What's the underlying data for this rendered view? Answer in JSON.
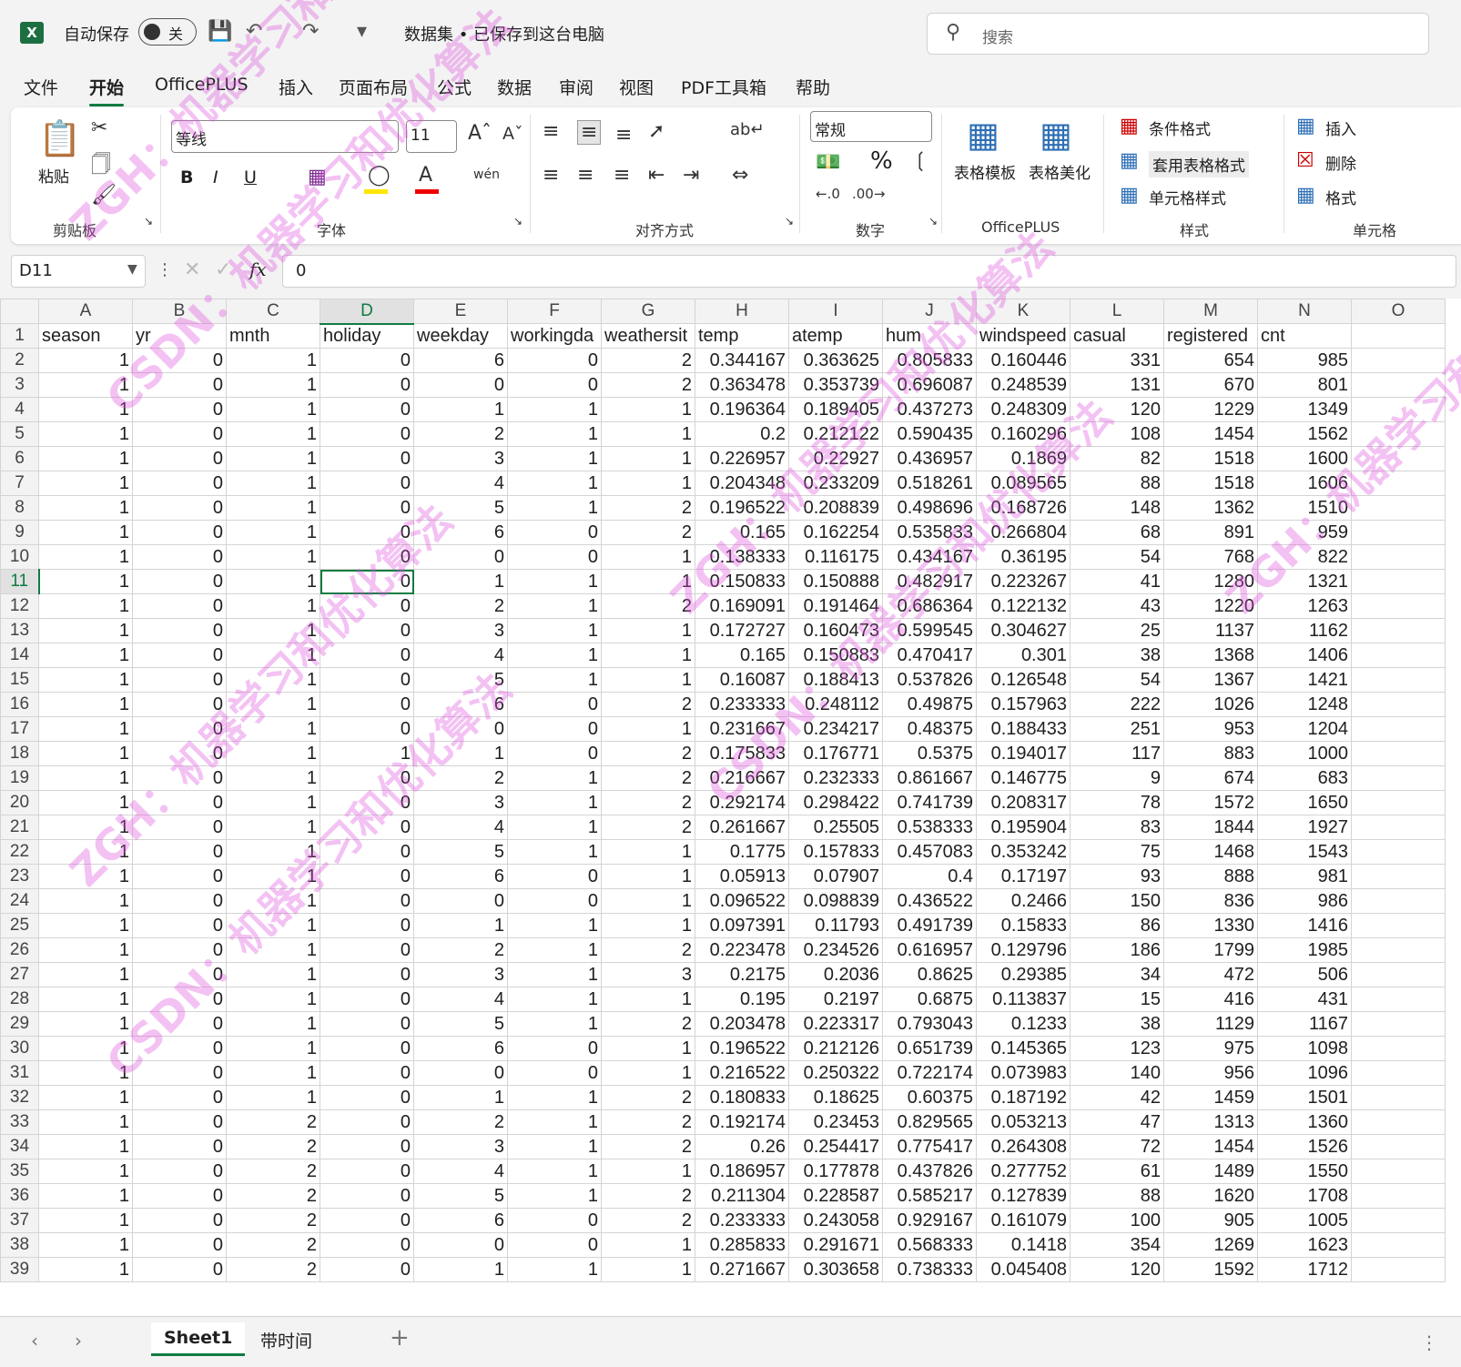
{
  "titlebar": {
    "app_icon_letter": "X",
    "autosave_label": "自动保存",
    "autosave_state": "关",
    "doc_title": "数据集 • 已保存到这台电脑",
    "search_placeholder": "搜索"
  },
  "menu_tabs": [
    "文件",
    "开始",
    "OfficePLUS",
    "插入",
    "页面布局",
    "公式",
    "数据",
    "审阅",
    "视图",
    "PDF工具箱",
    "帮助"
  ],
  "ribbon": {
    "clipboard": {
      "paste": "粘贴",
      "group": "剪贴板"
    },
    "font": {
      "name": "等线",
      "size": "11",
      "group": "字体",
      "bold": "B",
      "italic": "I",
      "underline": "U"
    },
    "alignment": {
      "group": "对齐方式"
    },
    "number": {
      "format": "常规",
      "group": "数字",
      "percent": "%"
    },
    "officeplus": {
      "template": "表格模板",
      "beautify": "表格美化",
      "group": "OfficePLUS"
    },
    "styles": {
      "conditional": "条件格式",
      "table_format": "套用表格格式",
      "cell_styles": "单元格样式",
      "group": "样式"
    },
    "cells": {
      "insert": "插入",
      "delete": "删除",
      "format": "格式",
      "group": "单元格"
    }
  },
  "formula_bar": {
    "name_box": "D11",
    "fx": "fx",
    "value": "0"
  },
  "grid": {
    "active_col": "D",
    "active_row": "11",
    "col_headers": [
      "A",
      "B",
      "C",
      "D",
      "E",
      "F",
      "G",
      "H",
      "I",
      "J",
      "K",
      "L",
      "M",
      "N",
      "O"
    ],
    "headers": [
      "season",
      "yr",
      "mnth",
      "holiday",
      "weekday",
      "workingda",
      "weathersit",
      "temp",
      "atemp",
      "hum",
      "windspeed",
      "casual",
      "registered",
      "cnt"
    ],
    "rows": [
      [
        "1",
        "0",
        "1",
        "0",
        "6",
        "0",
        "2",
        "0.344167",
        "0.363625",
        "0.805833",
        "0.160446",
        "331",
        "654",
        "985"
      ],
      [
        "1",
        "0",
        "1",
        "0",
        "0",
        "0",
        "2",
        "0.363478",
        "0.353739",
        "0.696087",
        "0.248539",
        "131",
        "670",
        "801"
      ],
      [
        "1",
        "0",
        "1",
        "0",
        "1",
        "1",
        "1",
        "0.196364",
        "0.189405",
        "0.437273",
        "0.248309",
        "120",
        "1229",
        "1349"
      ],
      [
        "1",
        "0",
        "1",
        "0",
        "2",
        "1",
        "1",
        "0.2",
        "0.212122",
        "0.590435",
        "0.160296",
        "108",
        "1454",
        "1562"
      ],
      [
        "1",
        "0",
        "1",
        "0",
        "3",
        "1",
        "1",
        "0.226957",
        "0.22927",
        "0.436957",
        "0.1869",
        "82",
        "1518",
        "1600"
      ],
      [
        "1",
        "0",
        "1",
        "0",
        "4",
        "1",
        "1",
        "0.204348",
        "0.233209",
        "0.518261",
        "0.089565",
        "88",
        "1518",
        "1606"
      ],
      [
        "1",
        "0",
        "1",
        "0",
        "5",
        "1",
        "2",
        "0.196522",
        "0.208839",
        "0.498696",
        "0.168726",
        "148",
        "1362",
        "1510"
      ],
      [
        "1",
        "0",
        "1",
        "0",
        "6",
        "0",
        "2",
        "0.165",
        "0.162254",
        "0.535833",
        "0.266804",
        "68",
        "891",
        "959"
      ],
      [
        "1",
        "0",
        "1",
        "0",
        "0",
        "0",
        "1",
        "0.138333",
        "0.116175",
        "0.434167",
        "0.36195",
        "54",
        "768",
        "822"
      ],
      [
        "1",
        "0",
        "1",
        "0",
        "1",
        "1",
        "1",
        "0.150833",
        "0.150888",
        "0.482917",
        "0.223267",
        "41",
        "1280",
        "1321"
      ],
      [
        "1",
        "0",
        "1",
        "0",
        "2",
        "1",
        "2",
        "0.169091",
        "0.191464",
        "0.686364",
        "0.122132",
        "43",
        "1220",
        "1263"
      ],
      [
        "1",
        "0",
        "1",
        "0",
        "3",
        "1",
        "1",
        "0.172727",
        "0.160473",
        "0.599545",
        "0.304627",
        "25",
        "1137",
        "1162"
      ],
      [
        "1",
        "0",
        "1",
        "0",
        "4",
        "1",
        "1",
        "0.165",
        "0.150883",
        "0.470417",
        "0.301",
        "38",
        "1368",
        "1406"
      ],
      [
        "1",
        "0",
        "1",
        "0",
        "5",
        "1",
        "1",
        "0.16087",
        "0.188413",
        "0.537826",
        "0.126548",
        "54",
        "1367",
        "1421"
      ],
      [
        "1",
        "0",
        "1",
        "0",
        "6",
        "0",
        "2",
        "0.233333",
        "0.248112",
        "0.49875",
        "0.157963",
        "222",
        "1026",
        "1248"
      ],
      [
        "1",
        "0",
        "1",
        "0",
        "0",
        "0",
        "1",
        "0.231667",
        "0.234217",
        "0.48375",
        "0.188433",
        "251",
        "953",
        "1204"
      ],
      [
        "1",
        "0",
        "1",
        "1",
        "1",
        "0",
        "2",
        "0.175833",
        "0.176771",
        "0.5375",
        "0.194017",
        "117",
        "883",
        "1000"
      ],
      [
        "1",
        "0",
        "1",
        "0",
        "2",
        "1",
        "2",
        "0.216667",
        "0.232333",
        "0.861667",
        "0.146775",
        "9",
        "674",
        "683"
      ],
      [
        "1",
        "0",
        "1",
        "0",
        "3",
        "1",
        "2",
        "0.292174",
        "0.298422",
        "0.741739",
        "0.208317",
        "78",
        "1572",
        "1650"
      ],
      [
        "1",
        "0",
        "1",
        "0",
        "4",
        "1",
        "2",
        "0.261667",
        "0.25505",
        "0.538333",
        "0.195904",
        "83",
        "1844",
        "1927"
      ],
      [
        "1",
        "0",
        "1",
        "0",
        "5",
        "1",
        "1",
        "0.1775",
        "0.157833",
        "0.457083",
        "0.353242",
        "75",
        "1468",
        "1543"
      ],
      [
        "1",
        "0",
        "1",
        "0",
        "6",
        "0",
        "1",
        "0.05913",
        "0.07907",
        "0.4",
        "0.17197",
        "93",
        "888",
        "981"
      ],
      [
        "1",
        "0",
        "1",
        "0",
        "0",
        "0",
        "1",
        "0.096522",
        "0.098839",
        "0.436522",
        "0.2466",
        "150",
        "836",
        "986"
      ],
      [
        "1",
        "0",
        "1",
        "0",
        "1",
        "1",
        "1",
        "0.097391",
        "0.11793",
        "0.491739",
        "0.15833",
        "86",
        "1330",
        "1416"
      ],
      [
        "1",
        "0",
        "1",
        "0",
        "2",
        "1",
        "2",
        "0.223478",
        "0.234526",
        "0.616957",
        "0.129796",
        "186",
        "1799",
        "1985"
      ],
      [
        "1",
        "0",
        "1",
        "0",
        "3",
        "1",
        "3",
        "0.2175",
        "0.2036",
        "0.8625",
        "0.29385",
        "34",
        "472",
        "506"
      ],
      [
        "1",
        "0",
        "1",
        "0",
        "4",
        "1",
        "1",
        "0.195",
        "0.2197",
        "0.6875",
        "0.113837",
        "15",
        "416",
        "431"
      ],
      [
        "1",
        "0",
        "1",
        "0",
        "5",
        "1",
        "2",
        "0.203478",
        "0.223317",
        "0.793043",
        "0.1233",
        "38",
        "1129",
        "1167"
      ],
      [
        "1",
        "0",
        "1",
        "0",
        "6",
        "0",
        "1",
        "0.196522",
        "0.212126",
        "0.651739",
        "0.145365",
        "123",
        "975",
        "1098"
      ],
      [
        "1",
        "0",
        "1",
        "0",
        "0",
        "0",
        "1",
        "0.216522",
        "0.250322",
        "0.722174",
        "0.073983",
        "140",
        "956",
        "1096"
      ],
      [
        "1",
        "0",
        "1",
        "0",
        "1",
        "1",
        "2",
        "0.180833",
        "0.18625",
        "0.60375",
        "0.187192",
        "42",
        "1459",
        "1501"
      ],
      [
        "1",
        "0",
        "2",
        "0",
        "2",
        "1",
        "2",
        "0.192174",
        "0.23453",
        "0.829565",
        "0.053213",
        "47",
        "1313",
        "1360"
      ],
      [
        "1",
        "0",
        "2",
        "0",
        "3",
        "1",
        "2",
        "0.26",
        "0.254417",
        "0.775417",
        "0.264308",
        "72",
        "1454",
        "1526"
      ],
      [
        "1",
        "0",
        "2",
        "0",
        "4",
        "1",
        "1",
        "0.186957",
        "0.177878",
        "0.437826",
        "0.277752",
        "61",
        "1489",
        "1550"
      ],
      [
        "1",
        "0",
        "2",
        "0",
        "5",
        "1",
        "2",
        "0.211304",
        "0.228587",
        "0.585217",
        "0.127839",
        "88",
        "1620",
        "1708"
      ],
      [
        "1",
        "0",
        "2",
        "0",
        "6",
        "0",
        "2",
        "0.233333",
        "0.243058",
        "0.929167",
        "0.161079",
        "100",
        "905",
        "1005"
      ],
      [
        "1",
        "0",
        "2",
        "0",
        "0",
        "0",
        "1",
        "0.285833",
        "0.291671",
        "0.568333",
        "0.1418",
        "354",
        "1269",
        "1623"
      ],
      [
        "1",
        "0",
        "2",
        "0",
        "1",
        "1",
        "1",
        "0.271667",
        "0.303658",
        "0.738333",
        "0.045408",
        "120",
        "1592",
        "1712"
      ]
    ]
  },
  "sheets": [
    "Sheet1",
    "带时间"
  ],
  "add_sheet": "+",
  "watermark": [
    "ZGH：机器学习和优化算法",
    "CSDN：机器学习和优化算法"
  ],
  "colors": {
    "accent": "#107c41",
    "watermark": "#dc50dc"
  }
}
